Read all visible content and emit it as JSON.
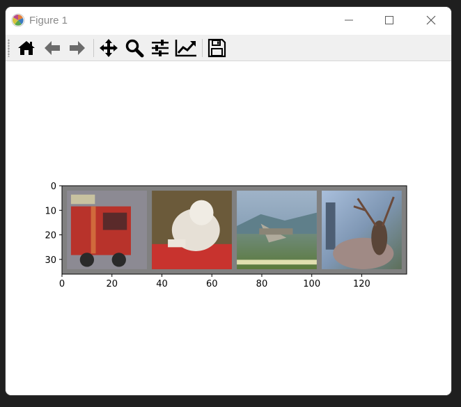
{
  "window": {
    "title": "Figure 1"
  },
  "toolbar": {
    "buttons": [
      {
        "name": "home",
        "icon": "home-icon"
      },
      {
        "name": "back",
        "icon": "arrow-left-icon"
      },
      {
        "name": "forward",
        "icon": "arrow-right-icon"
      },
      {
        "name": "pan",
        "icon": "move-icon"
      },
      {
        "name": "zoom",
        "icon": "magnifier-icon"
      },
      {
        "name": "configure-subplots",
        "icon": "sliders-icon"
      },
      {
        "name": "edit-axis",
        "icon": "line-chart-icon"
      },
      {
        "name": "save",
        "icon": "floppy-disk-icon"
      }
    ]
  },
  "chart_data": {
    "type": "image",
    "xlim": [
      0,
      138
    ],
    "ylim": [
      36,
      0
    ],
    "x_ticks": [
      0,
      20,
      40,
      60,
      80,
      100,
      120
    ],
    "y_ticks": [
      0,
      10,
      20,
      30
    ],
    "frame_color": "#808080",
    "tiles": [
      {
        "label": "truck",
        "x_range": [
          2,
          34
        ],
        "y_range": [
          2,
          34
        ]
      },
      {
        "label": "dog",
        "x_range": [
          36,
          68
        ],
        "y_range": [
          2,
          34
        ]
      },
      {
        "label": "plane",
        "x_range": [
          70,
          102
        ],
        "y_range": [
          2,
          34
        ]
      },
      {
        "label": "deer",
        "x_range": [
          104,
          136
        ],
        "y_range": [
          2,
          34
        ]
      }
    ]
  }
}
